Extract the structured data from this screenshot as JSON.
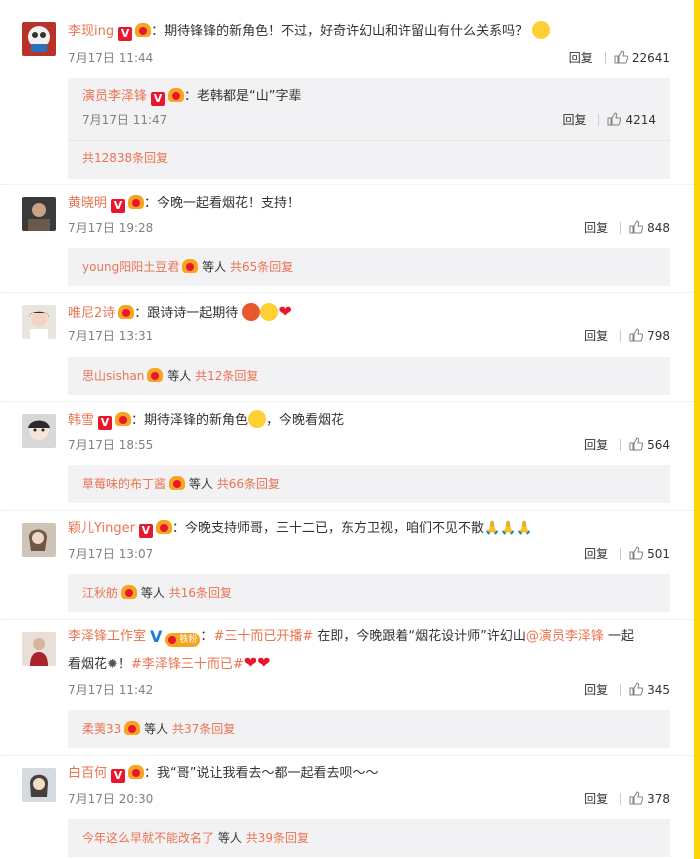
{
  "comments": [
    {
      "name": "李现ing",
      "text": "：期待锋锋的新角色！不过，好奇许幻山和许留山有什么关系吗？",
      "time": "7月17日 11:44",
      "reply_label": "回复",
      "likes": "22641",
      "sub": {
        "name": "演员李泽锋",
        "text": "：老韩都是“山”字辈",
        "time": "7月17日 11:47",
        "reply_label": "回复",
        "likes": "4214"
      },
      "total": "共12838条回复"
    },
    {
      "name": "黄晓明",
      "text": "：今晚一起看烟花！支持！",
      "time": "7月17日 19:28",
      "reply_label": "回复",
      "likes": "848",
      "preview_name": "young阳阳土豆君",
      "preview_suffix": "等人",
      "total": "共65条回复"
    },
    {
      "name": "唯尼2诗",
      "text": "：跟诗诗一起期待",
      "time": "7月17日 13:31",
      "reply_label": "回复",
      "likes": "798",
      "preview_name": "思山sishan",
      "preview_suffix": "等人",
      "total": "共12条回复"
    },
    {
      "name": "韩雪",
      "text": "：期待泽锋的新角色",
      "text2": "，今晚看烟花",
      "time": "7月17日 18:55",
      "reply_label": "回复",
      "likes": "564",
      "preview_name": "草莓味的布丁酱",
      "preview_suffix": "等人",
      "total": "共66条回复"
    },
    {
      "name": "颖儿Yinger",
      "text": "：今晚支持师哥，三十二已，东方卫视，咱们不见不散",
      "time": "7月17日 13:07",
      "reply_label": "回复",
      "likes": "501",
      "preview_name": "江秋舫",
      "preview_suffix": "等人",
      "total": "共16条回复"
    },
    {
      "name": "李泽锋工作室",
      "badge_text": "铁粉",
      "text_pre": "：",
      "topic1": "#三十而已开播#",
      "text_mid": " 在即，今晚跟着“烟花设计师”许幻山",
      "mention": "@演员李泽锋",
      "text_end": " 一起",
      "line2_pre": "看烟花",
      "line2_mid": "！",
      "topic2": "#李泽锋三十而已#",
      "time": "7月17日 11:42",
      "reply_label": "回复",
      "likes": "345",
      "preview_name": "柔荑33",
      "preview_suffix": "等人",
      "total": "共37条回复"
    },
    {
      "name": "白百何",
      "text": "：我“哥”说让我看去～都一起看去呗～～",
      "time": "7月17日 20:30",
      "reply_label": "回复",
      "likes": "378",
      "preview_name": "今年这么早就不能改名了",
      "preview_suffix": "等人",
      "total": "共39条回复"
    }
  ],
  "colors": {
    "accent": "#eb7350",
    "v_badge": "#e8172d",
    "scrollbar": "#ffd400",
    "reply_bg": "#f2f2f5"
  }
}
